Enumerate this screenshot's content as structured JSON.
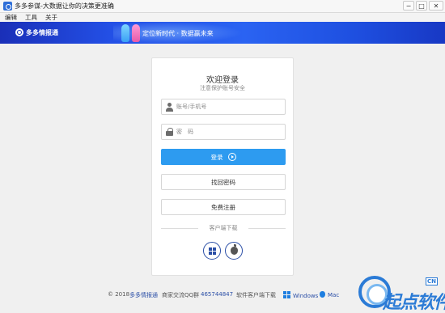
{
  "window": {
    "title": "多多参谋-大数据让你的决策更准确",
    "controls": {
      "minimize": "−",
      "maximize": "□",
      "close": "✕"
    }
  },
  "menu": [
    "编辑",
    "工具",
    "关于"
  ],
  "banner": {
    "logo_text": "多多情报通",
    "slogan": "定位新时代 · 数据赢未来"
  },
  "login": {
    "title": "欢迎登录",
    "subtitle": "注意保护账号安全",
    "username_placeholder": "账号/手机号",
    "password_placeholder": "密　码",
    "login_button": "登录",
    "recover_button": "找回密码",
    "register_button": "免费注册",
    "client_download_label": "客户端下载"
  },
  "footer": {
    "copyright": "© 2018",
    "brand": "多多情报通",
    "qq_label": "商家交流QQ群",
    "qq_number": "465744847",
    "download_label": "软件客户端下载",
    "windows": "Windows",
    "mac": "Mac"
  },
  "watermark": {
    "text": "起点软件",
    "small": "CN"
  },
  "colors": {
    "primary_button": "#2d9bf0",
    "banner": "#2350e6",
    "accent": "#2a4ea6"
  }
}
